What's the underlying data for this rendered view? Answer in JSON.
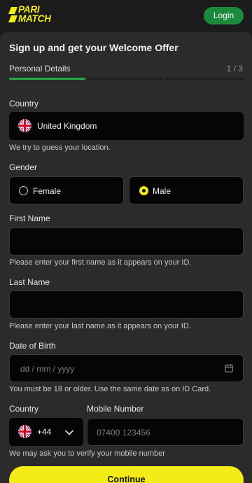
{
  "brand": {
    "logo_line1": "PARI",
    "logo_line2": "MATCH",
    "accent": "#f4ec16"
  },
  "header": {
    "login_label": "Login",
    "login_color": "#1b8a3c"
  },
  "form": {
    "title": "Sign up and get your Welcome Offer",
    "step_label": "Personal Details",
    "step_counter": "1 / 3",
    "steps_total": 3,
    "steps_completed": 1,
    "country": {
      "label": "Country",
      "value": "United Kingdom",
      "hint": "We try to guess your location.",
      "flag_icon": "uk-flag-icon"
    },
    "gender": {
      "label": "Gender",
      "options": [
        "Female",
        "Male"
      ],
      "selected": "Male"
    },
    "first_name": {
      "label": "First Name",
      "value": "",
      "hint": "Please enter your first name as it appears on your ID."
    },
    "last_name": {
      "label": "Last Name",
      "value": "",
      "hint": "Please enter your last name as it appears on your ID."
    },
    "dob": {
      "label": "Date of Birth",
      "placeholder": "dd / mm / yyyy",
      "hint": "You must be 18 or older. Use the same date as on ID Card.",
      "icon": "calendar-icon"
    },
    "phone": {
      "country_label": "Country",
      "number_label": "Mobile Number",
      "dial_code": "+44",
      "placeholder": "07400 123456",
      "hint": "We may ask you to verify your mobile number"
    },
    "continue_label": "Continue"
  }
}
